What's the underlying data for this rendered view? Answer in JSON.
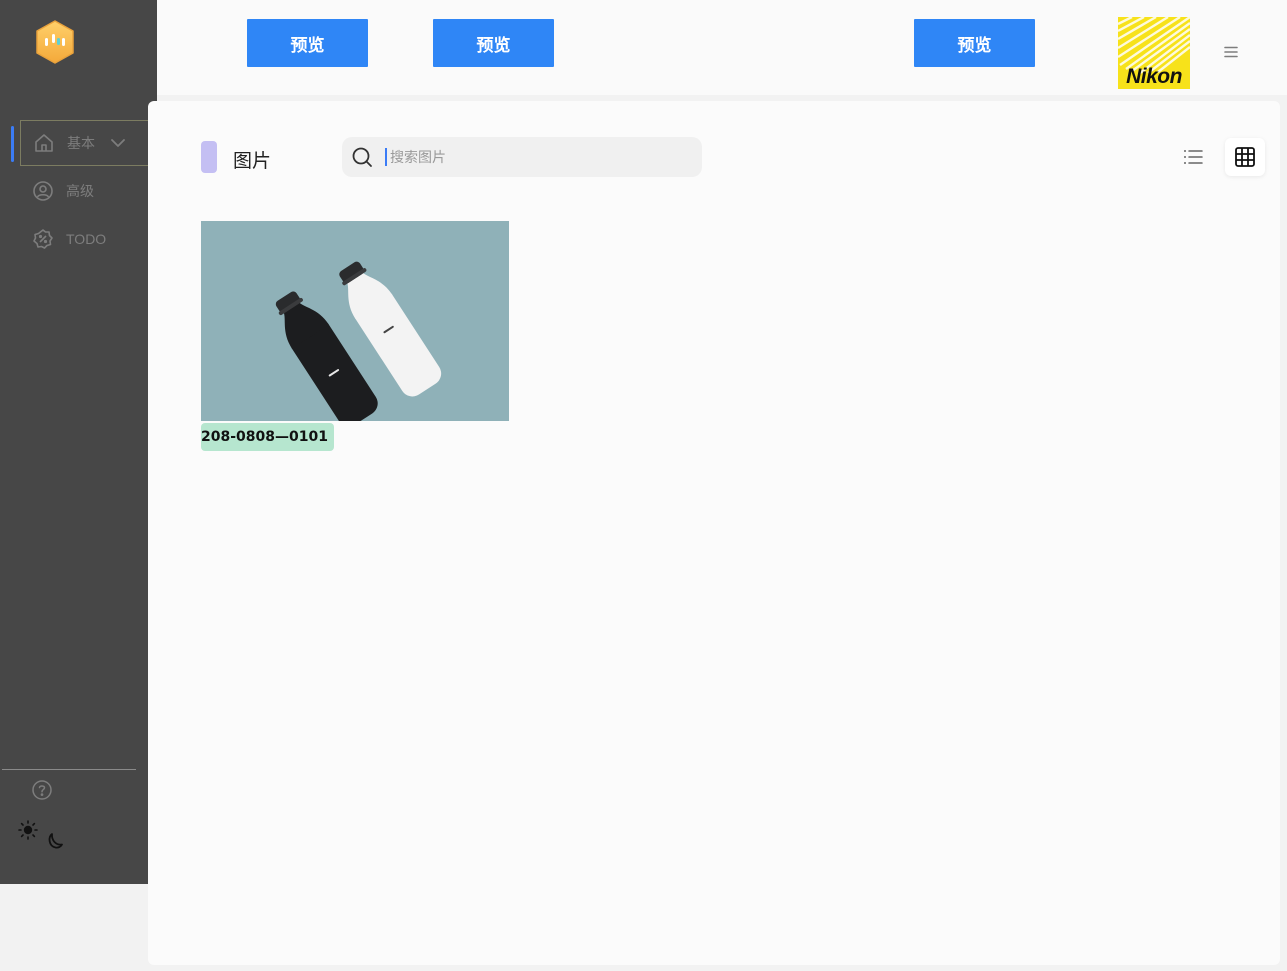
{
  "topbar": {
    "buttons": [
      "预览",
      "预览",
      "预览"
    ],
    "brand": "Nikon"
  },
  "sidebar": {
    "items": [
      {
        "label": "基本",
        "icon": "home-icon"
      },
      {
        "label": "高级",
        "icon": "user-circle-icon"
      },
      {
        "label": "TODO",
        "icon": "discount-badge-icon"
      }
    ]
  },
  "main": {
    "title": "图片",
    "search": {
      "placeholder": "搜索图片"
    },
    "images": [
      {
        "label": "208-0808—0101"
      }
    ]
  },
  "colors": {
    "accent": "#2f86f6",
    "sidebar_bg": "#474747",
    "title_marker": "#c4bff3",
    "card_label_bg": "#b6e6cf"
  }
}
